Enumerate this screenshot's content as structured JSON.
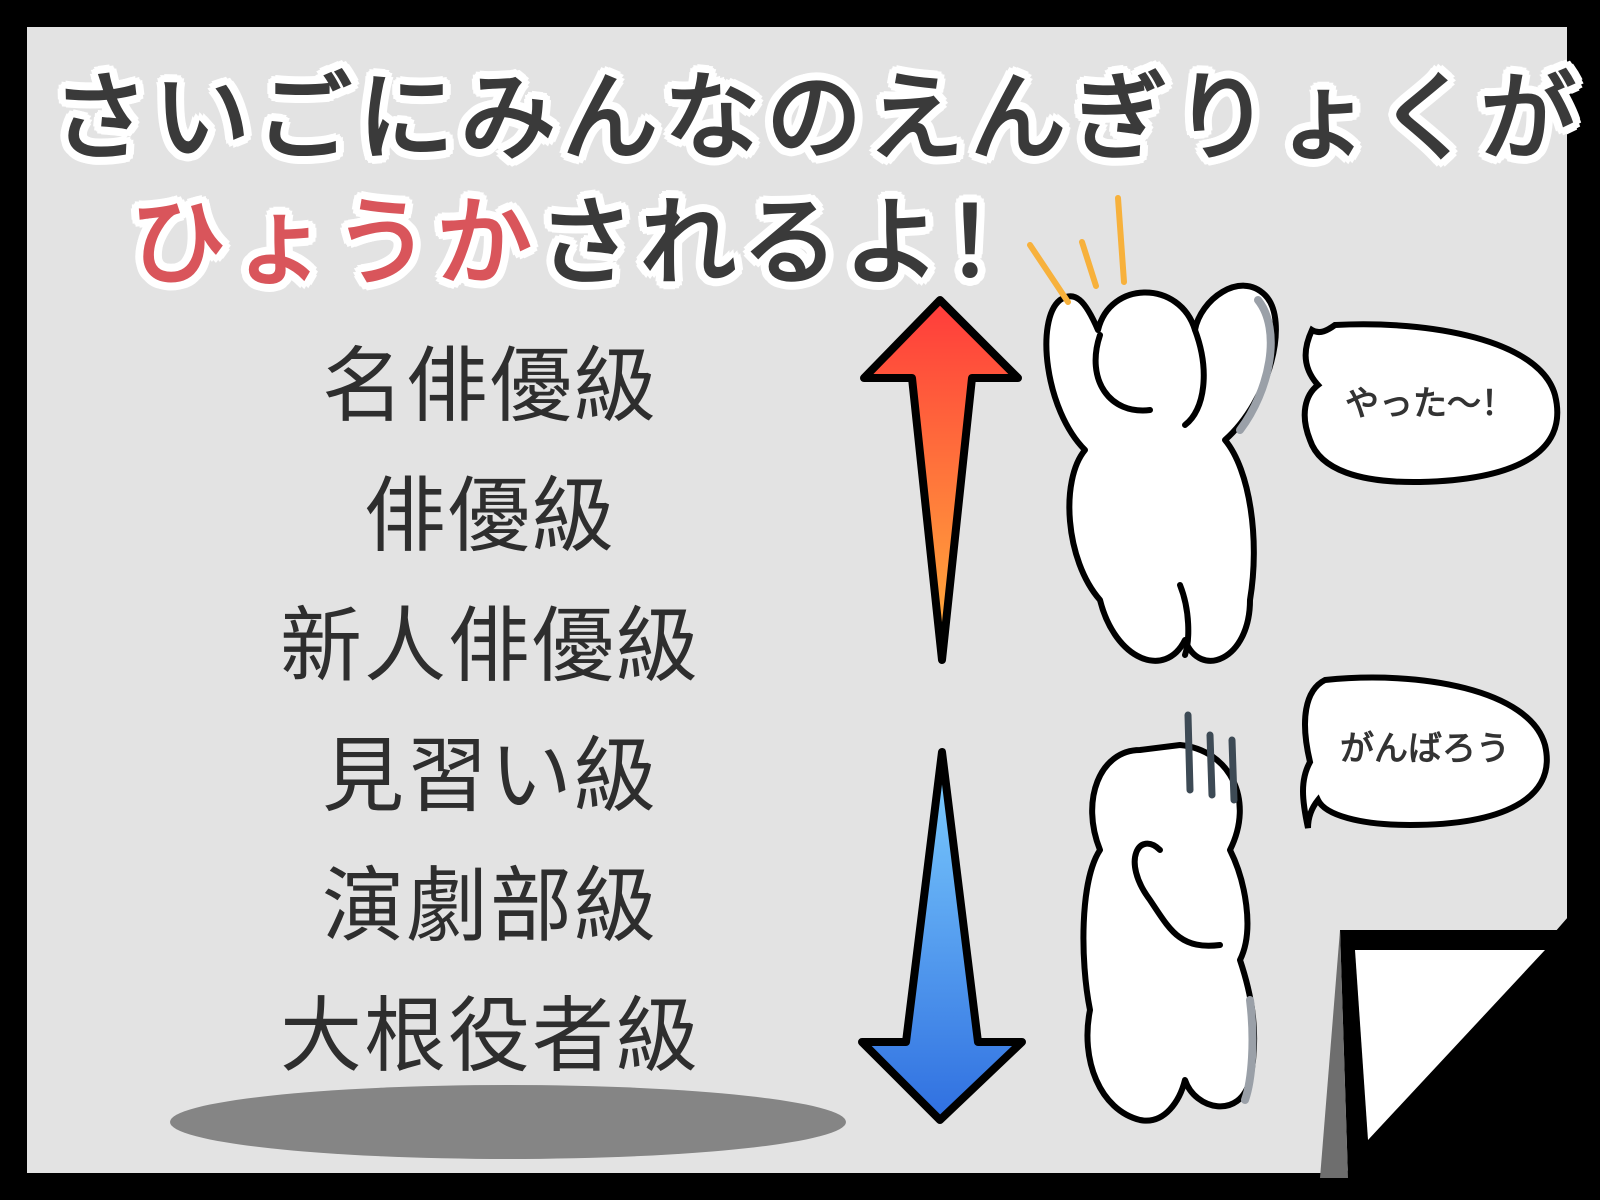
{
  "title": {
    "line1": "さいごにみんなのえんぎりょくが",
    "line2_accent": "ひょうか",
    "line2_rest": "されるよ！"
  },
  "ranks": [
    "名俳優級",
    "俳優級",
    "新人俳優級",
    "見習い級",
    "演劇部級",
    "大根役者級"
  ],
  "bubbles": {
    "happy": "やった〜！",
    "sad": "がんばろう"
  },
  "colors": {
    "panel_bg": "#e3e3e3",
    "border": "#000000",
    "title_accent": "#d9555b",
    "arrow_up_top": "#ff3b3b",
    "arrow_up_bottom": "#ffb23b",
    "arrow_down_top": "#6ec2ff",
    "arrow_down_bottom": "#2f6fe0"
  },
  "icons": [
    "arrow-up-icon",
    "arrow-down-icon",
    "happy-character-icon",
    "sad-character-icon",
    "page-curl-icon"
  ]
}
